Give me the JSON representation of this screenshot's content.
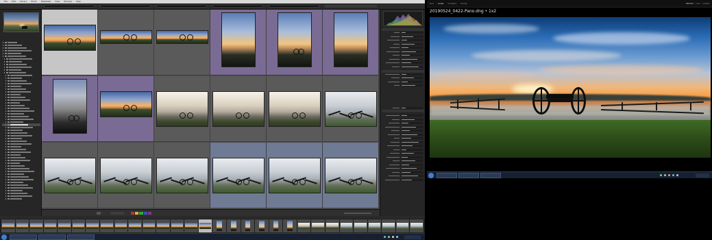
{
  "lightroom": {
    "menus": [
      "File",
      "Edit",
      "Library",
      "Photo",
      "Metadata",
      "View",
      "Window",
      "Help"
    ],
    "folders": [
      {
        "name": "",
        "count": "",
        "selected": false
      },
      {
        "name": "",
        "count": "",
        "selected": false
      },
      {
        "name": "",
        "count": "",
        "selected": false
      },
      {
        "name": "",
        "count": "",
        "selected": false
      },
      {
        "name": "",
        "count": "",
        "selected": false
      },
      {
        "name": "",
        "count": "",
        "selected": false
      },
      {
        "name": "",
        "count": "",
        "selected": false
      },
      {
        "name": "",
        "count": "",
        "selected": false
      }
    ],
    "grid_cells": [
      {
        "kind": "pano",
        "state": "selected",
        "orientation": "wide"
      },
      {
        "kind": "pano",
        "state": "normal",
        "orientation": "wide"
      },
      {
        "kind": "pano",
        "state": "normal",
        "orientation": "wide"
      },
      {
        "kind": "portrait",
        "state": "purple",
        "orientation": "tall"
      },
      {
        "kind": "portrait",
        "state": "purple",
        "orientation": "tall"
      },
      {
        "kind": "portrait",
        "state": "purple",
        "orientation": "tall"
      },
      {
        "kind": "tall",
        "state": "purple",
        "orientation": "tall"
      },
      {
        "kind": "pano",
        "state": "purple",
        "orientation": "wide"
      },
      {
        "kind": "fog",
        "state": "normal",
        "orientation": "wide"
      },
      {
        "kind": "fog",
        "state": "normal",
        "orientation": "wide"
      },
      {
        "kind": "fog",
        "state": "normal",
        "orientation": "wide"
      },
      {
        "kind": "fog2",
        "state": "normal",
        "orientation": "wide"
      },
      {
        "kind": "fog2",
        "state": "normal",
        "orientation": "wide"
      },
      {
        "kind": "fog2",
        "state": "normal",
        "orientation": "wide"
      },
      {
        "kind": "fog2",
        "state": "normal",
        "orientation": "wide"
      },
      {
        "kind": "fog2",
        "state": "blue",
        "orientation": "wide"
      },
      {
        "kind": "fog2",
        "state": "blue",
        "orientation": "wide"
      },
      {
        "kind": "fog2",
        "state": "blue",
        "orientation": "wide"
      }
    ],
    "colors": {
      "accent_purple": "#7a6b94",
      "selected_cell": "#c6c6c6",
      "grid_bg": "#4b4b4b",
      "blue_cell": "#6f7a95"
    }
  },
  "secondary": {
    "tabs": [
      "Grid",
      "Loupe",
      "Compare",
      "Survey"
    ],
    "active_tab": "Loupe",
    "modes": [
      "Normal",
      "Live",
      "Locked"
    ],
    "filename": "20190524_0422-Pano.dng • 1x2",
    "subinfo": "",
    "status": ""
  },
  "taskbar": {
    "buttons": [
      "",
      "",
      "",
      "",
      ""
    ],
    "right_buttons": [
      "",
      "",
      "",
      "",
      ""
    ]
  }
}
